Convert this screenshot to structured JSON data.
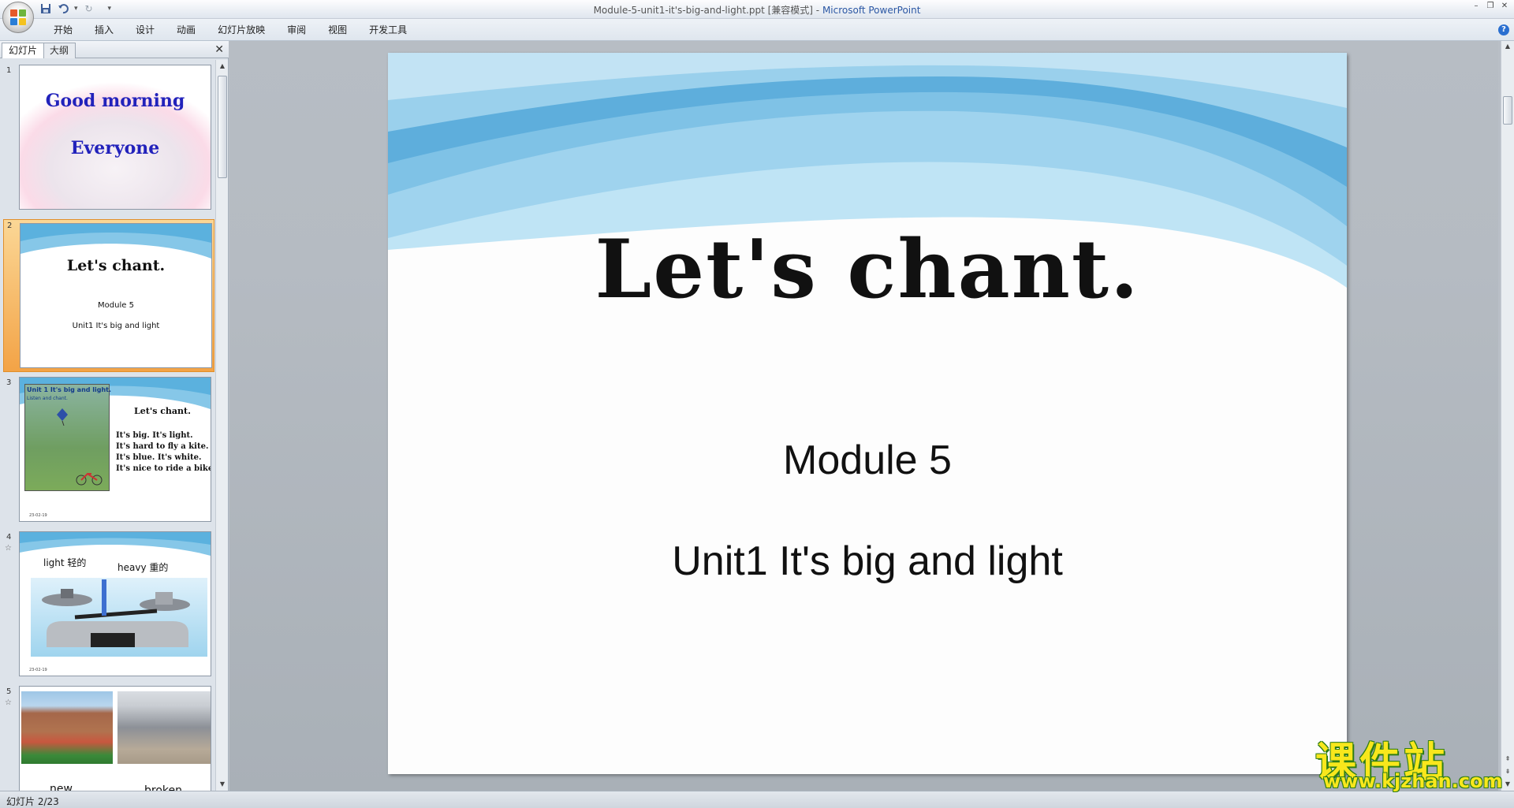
{
  "titlebar": {
    "document_name": "Module-5-unit1-it's-big-and-light.ppt [兼容模式]",
    "separator": " - ",
    "app_name": "Microsoft PowerPoint"
  },
  "ribbon": {
    "tabs": [
      "开始",
      "插入",
      "设计",
      "动画",
      "幻灯片放映",
      "审阅",
      "视图",
      "开发工具"
    ]
  },
  "left_pane": {
    "tabs": [
      "幻灯片",
      "大纲"
    ],
    "close_glyph": "✕"
  },
  "thumbnails": [
    {
      "number": "1",
      "title": "Good morning",
      "title2": "Everyone"
    },
    {
      "number": "2",
      "title": "Let's chant.",
      "sub1": "Module 5",
      "sub2": "Unit1 It's big and light"
    },
    {
      "number": "3",
      "image_heading": "Unit 1 It's big and light.",
      "image_caption": "Listen and chant.",
      "title": "Let's chant.",
      "lines": [
        "It's big.     It's light.",
        "It's hard  to  fly  a kite.",
        "It's blue.   It's white.",
        "It's nice to ride a bike."
      ],
      "date": "23-02-19"
    },
    {
      "number": "4",
      "left_label": "light 轻的",
      "right_label": "heavy 重的",
      "date": "23-02-19"
    },
    {
      "number": "5",
      "left_label": "new",
      "right_label": "broken"
    }
  ],
  "slide": {
    "title": "Let's chant.",
    "subtitle1": "Module 5",
    "subtitle2": "Unit1 It's big and light"
  },
  "statusbar": {
    "slide_counter": "幻灯片 2/23"
  },
  "watermark": {
    "main": "课件站",
    "url": "www.kjzhan.com"
  },
  "colors": {
    "thumb_title_blue": "#2222bb",
    "watermark_yellow": "#f8e71c",
    "watermark_green": "#2e7d16",
    "selection_orange": "#f3a346"
  }
}
